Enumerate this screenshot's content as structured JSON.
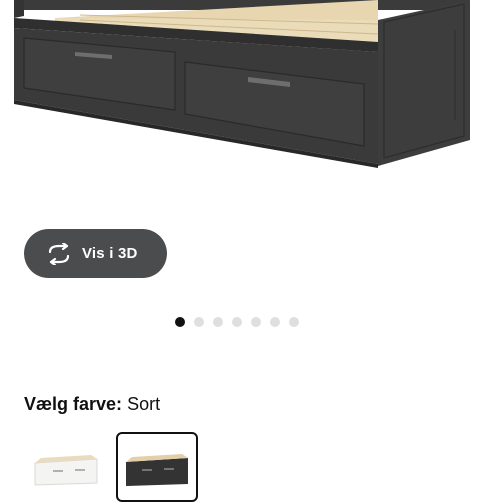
{
  "product_view": {
    "image_icon": "daybed-with-drawers-image",
    "view_3d_label": "Vis i 3D",
    "view_3d_icon": "rotate-arrows-icon",
    "carousel": {
      "total": 7,
      "active_index": 0
    }
  },
  "color_picker": {
    "prompt_label": "Vælg farve:",
    "selected_value": "Sort",
    "options": [
      {
        "icon": "white-daybed-swatch",
        "color": "#f2f2f0",
        "selected": false
      },
      {
        "icon": "black-daybed-swatch",
        "color": "#2f2f30",
        "selected": true
      }
    ]
  },
  "colors": {
    "button_bg": "#4b4c4e",
    "dot_active": "#111111",
    "dot_inactive": "#dfdfdf",
    "frame": "#3a3a3b",
    "slats": "#e9d7b3"
  }
}
